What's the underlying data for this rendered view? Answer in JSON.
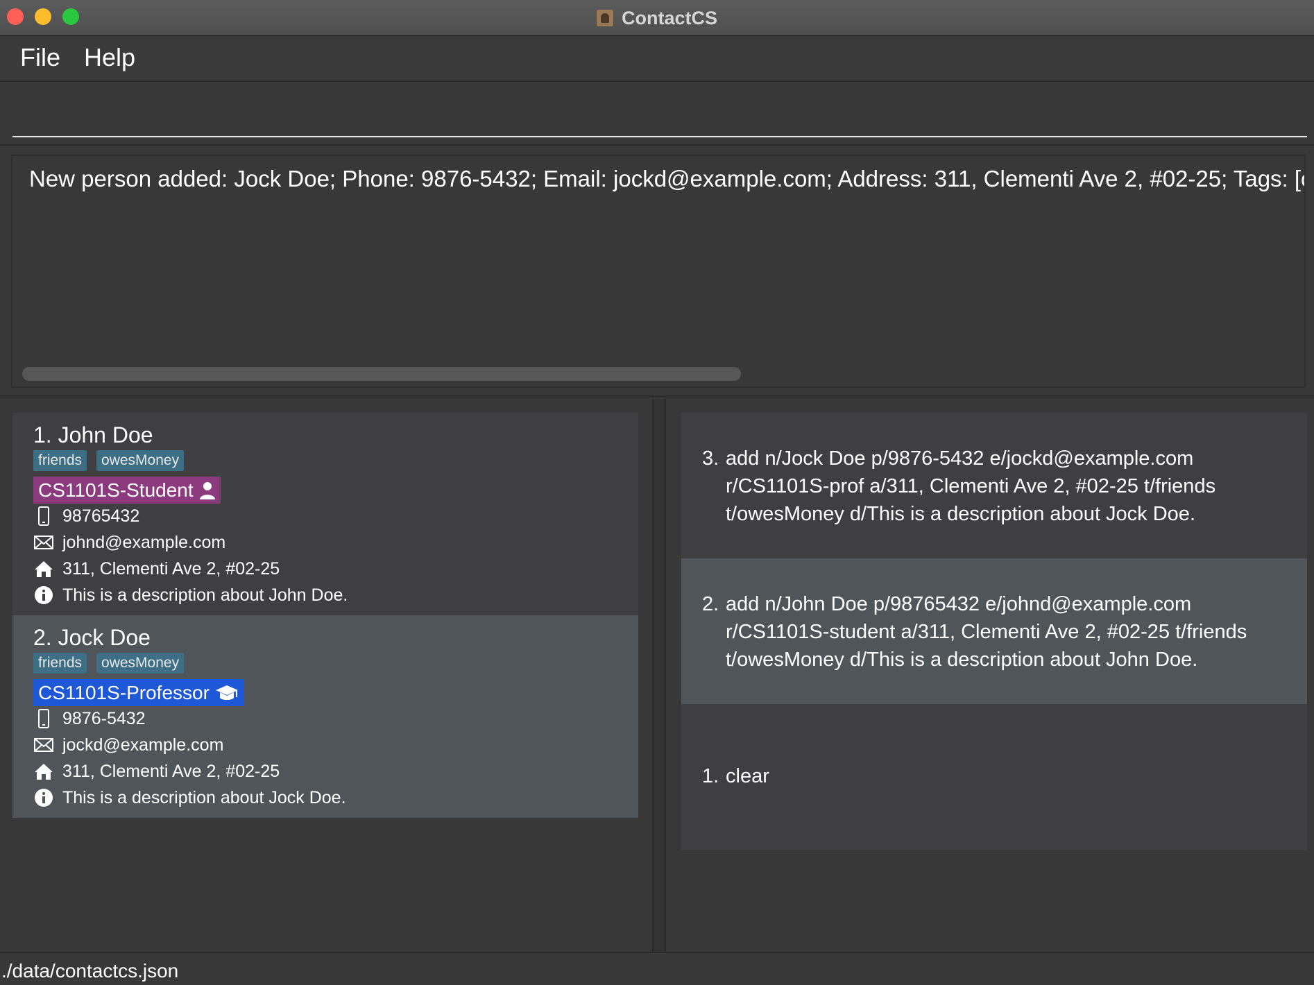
{
  "window": {
    "title": "ContactCS"
  },
  "menu": {
    "file": "File",
    "help": "Help"
  },
  "command_box": {
    "value": ""
  },
  "result_display": {
    "text": "New person added: Jock Doe; Phone: 9876-5432; Email: jockd@example.com; Address: 311, Clementi Ave 2, #02-25; Tags: [owesMoney][friends]"
  },
  "persons": [
    {
      "name": "1. John Doe",
      "tags": [
        "friends",
        "owesMoney"
      ],
      "role": "CS1101S-Student",
      "role_icon": "person-icon",
      "role_color": "#8b3a7e",
      "phone": "98765432",
      "email": "johnd@example.com",
      "address": "311, Clementi Ave 2, #02-25",
      "description": "This is a description about John Doe."
    },
    {
      "name": "2. Jock Doe",
      "tags": [
        "friends",
        "owesMoney"
      ],
      "role": "CS1101S-Professor",
      "role_icon": "graduation-cap-icon",
      "role_color": "#1f58d6",
      "phone": "9876-5432",
      "email": "jockd@example.com",
      "address": "311, Clementi Ave 2, #02-25",
      "description": "This is a description about Jock Doe."
    }
  ],
  "history": [
    {
      "number": "3.",
      "command": "add n/Jock Doe p/9876-5432 e/jockd@example.com r/CS1101S-prof a/311, Clementi Ave 2, #02-25 t/friends t/owesMoney d/This is a description about Jock Doe."
    },
    {
      "number": "2.",
      "command": "add n/John Doe p/98765432 e/johnd@example.com r/CS1101S-student a/311, Clementi Ave 2, #02-25 t/friends t/owesMoney d/This is a description about John Doe."
    },
    {
      "number": "1.",
      "command": "clear"
    }
  ],
  "status": {
    "path": "./data/contactcs.json"
  },
  "colors": {
    "background": "#383838",
    "tag": "#3c6e86",
    "selected_row": "#4f5558"
  }
}
